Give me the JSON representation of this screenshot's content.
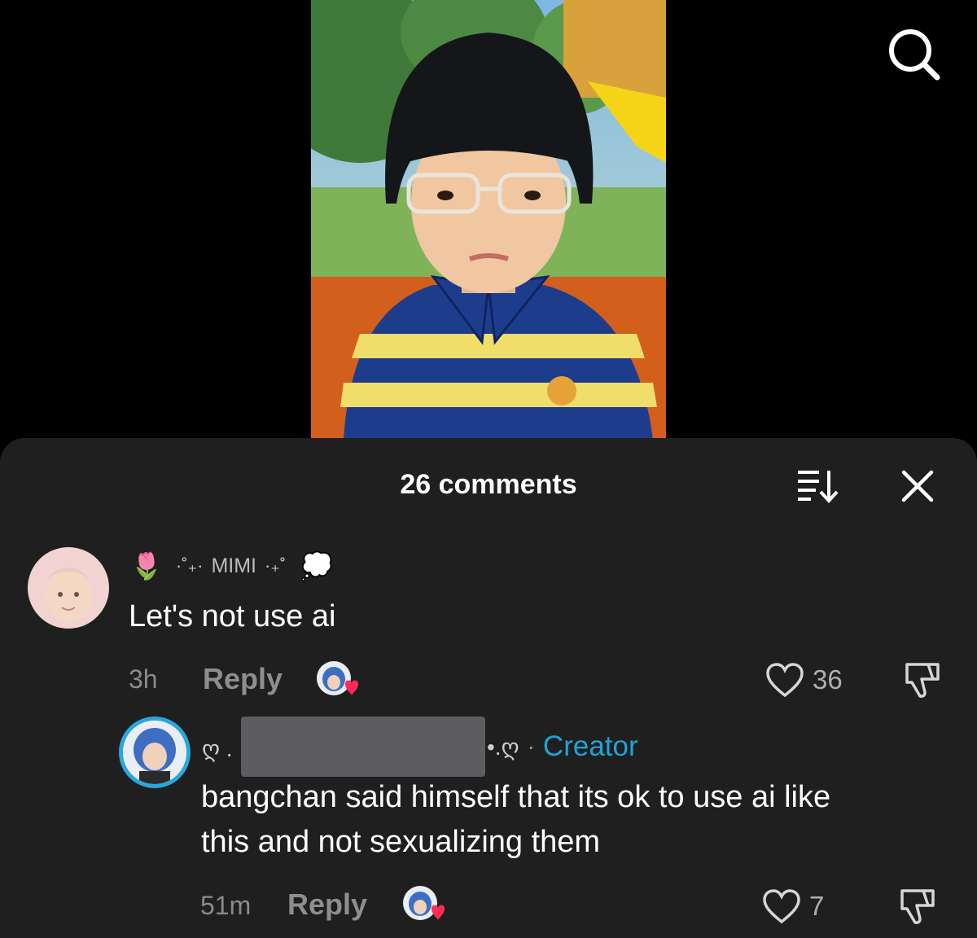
{
  "video": {
    "description_icon": "video-thumbnail"
  },
  "header": {
    "search_icon": "search-icon"
  },
  "comments_panel": {
    "title": "26 comments",
    "sort_icon": "sort-icon",
    "close_icon": "close-icon"
  },
  "comments": [
    {
      "emoji_prefix": "🌷",
      "deco_left": "·˚₊·",
      "username": "MIMI",
      "deco_right": "·₊˚",
      "emoji_suffix": "💭",
      "text": "Let's not use ai",
      "time": "3h",
      "reply_label": "Reply",
      "likes": "36"
    },
    {
      "name_prefix": "ღ .",
      "name_suffix": "•.ღ",
      "separator": "·",
      "creator_label": "Creator",
      "text_line1": "bangchan said himself that its ok to use ai like",
      "text_line2": "this and not sexualizing them",
      "time": "51m",
      "reply_label": "Reply",
      "likes": "7"
    }
  ],
  "colors": {
    "sheet_bg": "#1f1f1f",
    "creator": "#22a3d6",
    "heart": "#fe2c55"
  }
}
